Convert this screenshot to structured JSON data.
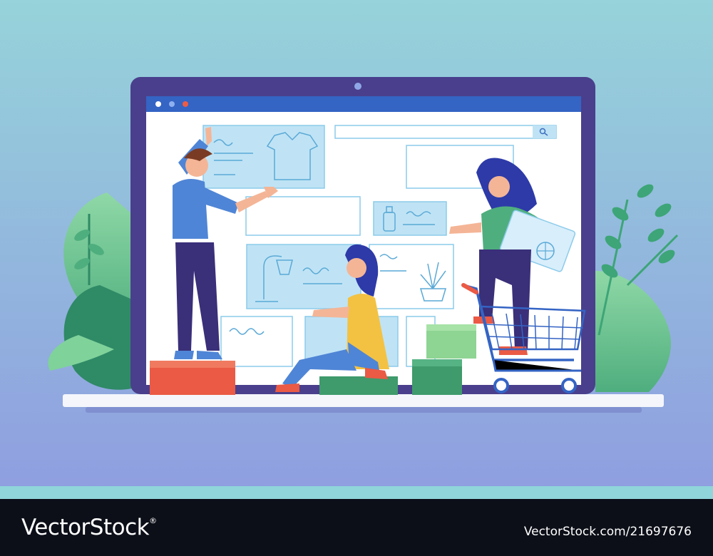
{
  "illustration": {
    "subject": "team building an online shop page on a laptop screen",
    "colors": {
      "bg_top": "#96d3da",
      "bg_bottom": "#8f9ee0",
      "laptop_frame": "#4a3f8c",
      "browser_bar": "#3464c4",
      "card_fill": "#bfe3f5",
      "card_stroke": "#8ccbea",
      "box_red": "#ea5a45",
      "box_green": "#3f9a6c",
      "box_light_green": "#8ed493",
      "leaves": "#3da577"
    },
    "icons": [
      "search-icon",
      "tshirt-icon",
      "bottle-icon",
      "lamp-icon",
      "plant-icon",
      "basketball-icon",
      "shopping-cart-icon"
    ]
  },
  "footer": {
    "brand": "VectorStock",
    "registered": "®",
    "image_id": "VectorStock.com/21697676"
  }
}
